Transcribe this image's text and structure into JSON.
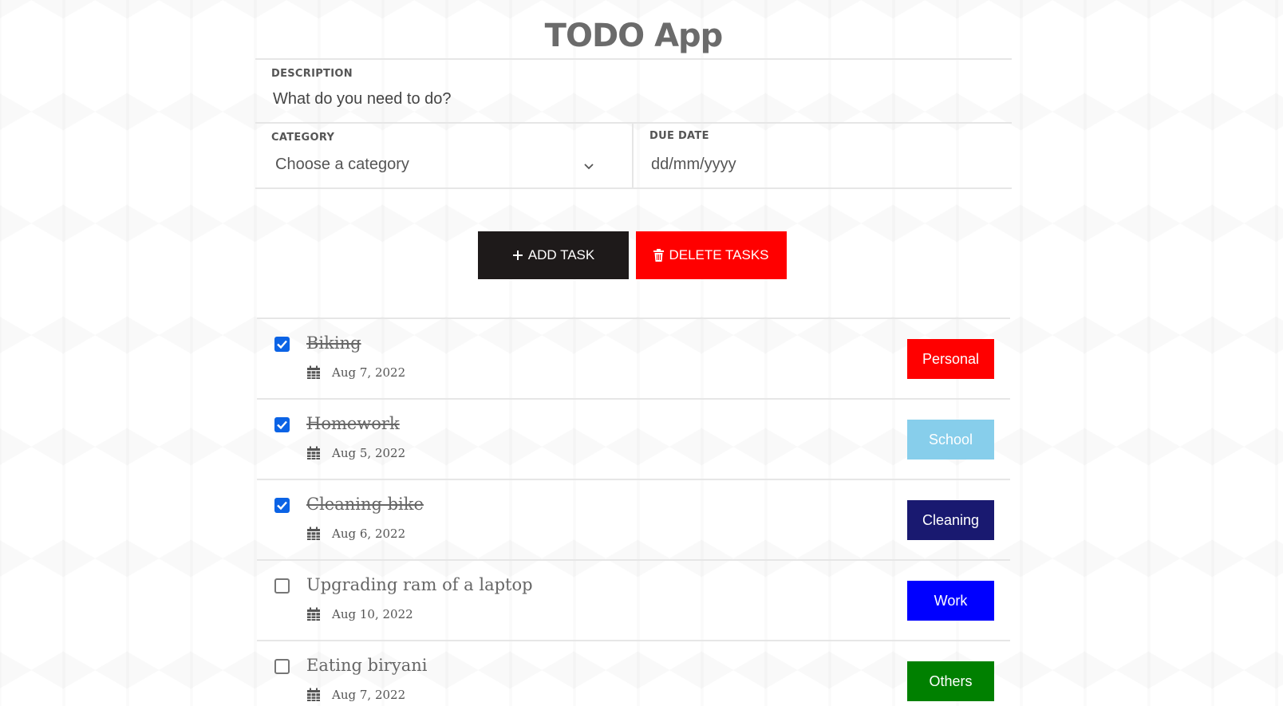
{
  "title": "TODO App",
  "form": {
    "description_label": "DESCRIPTION",
    "description_placeholder": "What do you need to do?",
    "category_label": "CATEGORY",
    "category_placeholder": "Choose a category",
    "due_date_label": "DUE DATE",
    "due_date_placeholder": "dd/mm/yyyy"
  },
  "actions": {
    "add_label": "ADD TASK",
    "delete_label": "DELETE TASKS"
  },
  "tasks": [
    {
      "title": "Biking",
      "date": "Aug 7, 2022",
      "category": "Personal",
      "done": true,
      "color": "#ff0000"
    },
    {
      "title": "Homework",
      "date": "Aug 5, 2022",
      "category": "School",
      "done": true,
      "color": "#87ceeb"
    },
    {
      "title": "Cleaning bike",
      "date": "Aug 6, 2022",
      "category": "Cleaning",
      "done": true,
      "color": "#191970"
    },
    {
      "title": "Upgrading ram of a laptop",
      "date": "Aug 10, 2022",
      "category": "Work",
      "done": false,
      "color": "#0000ff"
    },
    {
      "title": "Eating biryani",
      "date": "Aug 7, 2022",
      "category": "Others",
      "done": false,
      "color": "#008000"
    }
  ]
}
